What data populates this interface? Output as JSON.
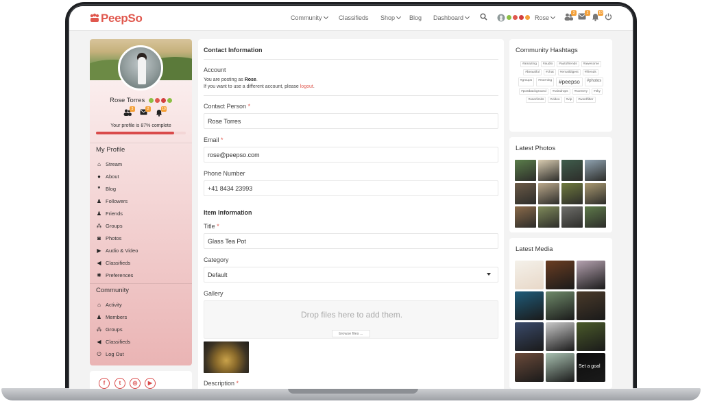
{
  "navbar": {
    "logo": "PeepSo",
    "items": [
      {
        "label": "Community",
        "dropdown": true
      },
      {
        "label": "Classifieds",
        "dropdown": false
      },
      {
        "label": "Shop",
        "dropdown": true
      },
      {
        "label": "Blog",
        "dropdown": false
      },
      {
        "label": "Dashboard",
        "dropdown": true
      }
    ],
    "user": "Rose",
    "badges": {
      "friends": "3",
      "messages": "2",
      "notifications": "10"
    }
  },
  "profile": {
    "name": "Rose Torres",
    "progress_text": "Your profile is 87% complete",
    "progress": 0.87,
    "badges": {
      "friends": "3",
      "messages": "2",
      "notifications": "10"
    }
  },
  "my_profile": {
    "title": "My Profile",
    "items": [
      "Stream",
      "About",
      "Blog",
      "Followers",
      "Friends",
      "Groups",
      "Photos",
      "Audio & Video",
      "Classifieds",
      "Preferences"
    ]
  },
  "community": {
    "title": "Community",
    "items": [
      "Activity",
      "Members",
      "Groups",
      "Classifieds",
      "Log Out"
    ]
  },
  "form": {
    "contact_title": "Contact Information",
    "account_label": "Account",
    "posting_as_prefix": "You are posting as ",
    "posting_as_name": "Rose",
    "posting_as_suffix": ".",
    "different_account": "If you want to use a different account, please ",
    "logout_link": "logout",
    "contact_person_label": "Contact Person",
    "contact_person_value": "Rose Torres",
    "email_label": "Email",
    "email_value": "rose@peepso.com",
    "phone_label": "Phone Number",
    "phone_value": "+41 8434 23993",
    "item_title": "Item Information",
    "title_label": "Title",
    "title_value": "Glass Tea Pot",
    "category_label": "Category",
    "category_value": "Default",
    "gallery_label": "Gallery",
    "dropzone_text": "Drop files here to add them.",
    "browse_label": "browse files ...",
    "description_label": "Description",
    "required_mark": "*"
  },
  "hashtags": {
    "title": "Community Hashtags",
    "tags": [
      {
        "t": "#amazing",
        "s": ""
      },
      {
        "t": "#audio",
        "s": ""
      },
      {
        "t": "#autofriends",
        "s": ""
      },
      {
        "t": "#awesome",
        "s": ""
      },
      {
        "t": "#beautiful",
        "s": ""
      },
      {
        "t": "#chat",
        "s": ""
      },
      {
        "t": "#emaildigest",
        "s": ""
      },
      {
        "t": "#friends",
        "s": ""
      },
      {
        "t": "#groups",
        "s": ""
      },
      {
        "t": "#morning",
        "s": ""
      },
      {
        "t": "#peepso",
        "s": "big"
      },
      {
        "t": "#photos",
        "s": "med"
      },
      {
        "t": "#postbackground",
        "s": ""
      },
      {
        "t": "#raindrops",
        "s": ""
      },
      {
        "t": "#scenery",
        "s": ""
      },
      {
        "t": "#sky",
        "s": ""
      },
      {
        "t": "#userlimits",
        "s": ""
      },
      {
        "t": "#video",
        "s": ""
      },
      {
        "t": "#vip",
        "s": ""
      },
      {
        "t": "#wordfilter",
        "s": ""
      }
    ]
  },
  "latest_photos": {
    "title": "Latest Photos",
    "colors": [
      "#5a7d4a",
      "#d8cbb0",
      "#3f5d4c",
      "#8fa2b0",
      "#6b5a47",
      "#b9a78a",
      "#6f7a3e",
      "#a89870",
      "#8a6a4a",
      "#7f8a5a",
      "#6e6e6a",
      "#5e7a4a"
    ]
  },
  "latest_media": {
    "title": "Latest Media",
    "items": [
      {
        "label": "",
        "color": "#f4f1ea"
      },
      {
        "label": "",
        "color": "#6a3d22"
      },
      {
        "label": "",
        "color": "#b5a2b0"
      },
      {
        "label": "",
        "color": "#1f5c7a"
      },
      {
        "label": "",
        "color": "#6f8a6a"
      },
      {
        "label": "",
        "color": "#4a3a2a"
      },
      {
        "label": "",
        "color": "#3a4a6a"
      },
      {
        "label": "",
        "color": "#c9c9c9"
      },
      {
        "label": "",
        "color": "#4a5a2a"
      },
      {
        "label": "",
        "color": "#6a4a3a"
      },
      {
        "label": "",
        "color": "#a8c0b0"
      },
      {
        "label": "Set a goal",
        "color": "#0d0d0d"
      }
    ]
  }
}
